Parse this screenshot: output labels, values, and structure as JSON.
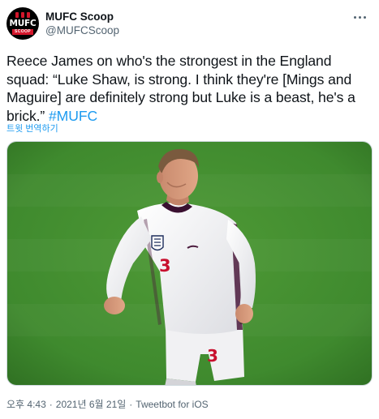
{
  "author": {
    "display_name": "MUFC Scoop",
    "handle": "@MUFCScoop",
    "avatar_text": "MUFC",
    "avatar_subtext": "SCOOP"
  },
  "tweet": {
    "text": "Reece James on who's the strongest in the England squad: “Luke Shaw, is strong. I think they're [Mings and Maguire] are definitely strong but Luke is a beast, he's a brick.” ",
    "hashtag": "#MUFC",
    "translate_label": "트윗 번역하기"
  },
  "media": {
    "shirt_number": "3"
  },
  "meta": {
    "time": "오후 4:43",
    "separator1": "·",
    "date": "2021년 6월 21일",
    "separator2": "·",
    "source": "Tweetbot for iOS"
  },
  "icons": {
    "more": "more-options-icon",
    "crest": "three-lions-crest-icon"
  },
  "colors": {
    "link": "#1d9bf0",
    "secondary_text": "#536471",
    "brand_red": "#d3162b",
    "pitch_green": "#3f8a2e"
  }
}
